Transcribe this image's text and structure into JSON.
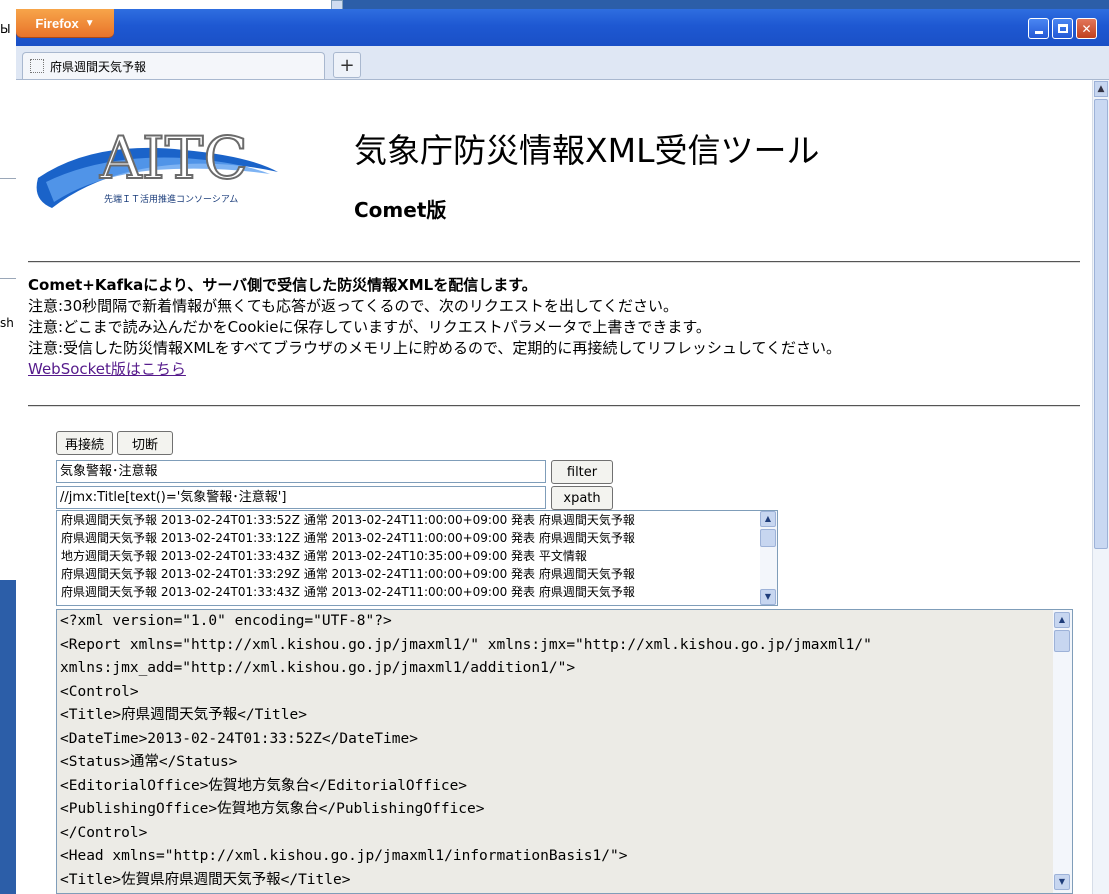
{
  "background": {
    "fragments": [
      "Ы",
      "sh"
    ]
  },
  "window": {
    "firefox_button": "Firefox",
    "tab_title": "府県週間天気予報",
    "new_tab": "+"
  },
  "header": {
    "logo_text": "AITC",
    "logo_subtext": "先端ＩＴ活用推進コンソーシアム",
    "title": "気象庁防災情報XML受信ツール",
    "subtitle": "Comet版"
  },
  "intro": {
    "lead": "Comet+Kafkaにより、サーバ側で受信した防災情報XMLを配信します。",
    "notes": [
      "注意:30秒間隔で新着情報が無くても応答が返ってくるので、次のリクエストを出してください。",
      "注意:どこまで読み込んだかをCookieに保存していますが、リクエストパラメータで上書きできます。",
      "注意:受信した防災情報XMLをすべてブラウザのメモリ上に貯めるので、定期的に再接続してリフレッシュしてください。"
    ],
    "link": "WebSocket版はこちら"
  },
  "controls": {
    "reconnect": "再接続",
    "disconnect": "切断",
    "filter_value": "気象警報･注意報",
    "filter_button": "filter",
    "xpath_value": "//jmx:Title[text()='気象警報･注意報']",
    "xpath_button": "xpath"
  },
  "messages": [
    "府県週間天気予報 2013-02-24T01:33:52Z 通常 2013-02-24T11:00:00+09:00 発表 府県週間天気予報",
    "府県週間天気予報 2013-02-24T01:33:12Z 通常 2013-02-24T11:00:00+09:00 発表 府県週間天気予報",
    "地方週間天気予報 2013-02-24T01:33:43Z 通常 2013-02-24T10:35:00+09:00 発表 平文情報",
    "府県週間天気予報 2013-02-24T01:33:29Z 通常 2013-02-24T11:00:00+09:00 発表 府県週間天気予報",
    "府県週間天気予報 2013-02-24T01:33:43Z 通常 2013-02-24T11:00:00+09:00 発表 府県週間天気予報"
  ],
  "xml_lines": [
    "<?xml version=\"1.0\" encoding=\"UTF-8\"?>",
    "<Report xmlns=\"http://xml.kishou.go.jp/jmaxml1/\" xmlns:jmx=\"http://xml.kishou.go.jp/jmaxml1/\"",
    "xmlns:jmx_add=\"http://xml.kishou.go.jp/jmaxml1/addition1/\">",
    "<Control>",
    "<Title>府県週間天気予報</Title>",
    "<DateTime>2013-02-24T01:33:52Z</DateTime>",
    "<Status>通常</Status>",
    "<EditorialOffice>佐賀地方気象台</EditorialOffice>",
    "<PublishingOffice>佐賀地方気象台</PublishingOffice>",
    "</Control>",
    "<Head xmlns=\"http://xml.kishou.go.jp/jmaxml1/informationBasis1/\">",
    "<Title>佐賀県府県週間天気予報</Title>"
  ],
  "colors": {
    "titlebar": "#1e58d2",
    "firefox_button": "#e8732a",
    "link": "#551a8b",
    "xml_background": "#ecebe6"
  }
}
